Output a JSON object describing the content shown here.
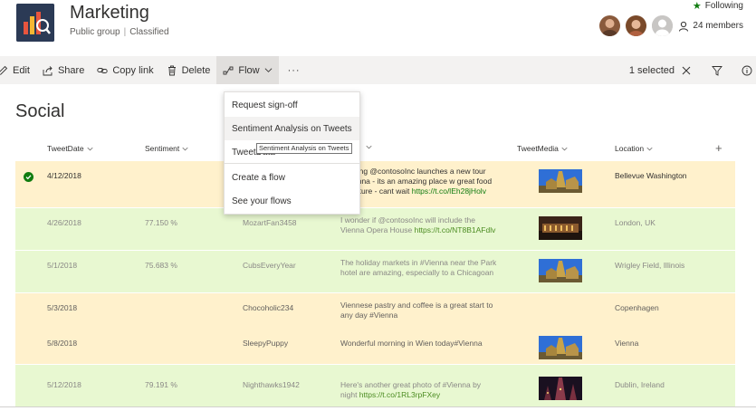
{
  "site": {
    "title": "Marketing",
    "group_type": "Public group",
    "classification": "Classified",
    "following": "Following",
    "members": "24 members"
  },
  "commands": {
    "edit": "Edit",
    "share": "Share",
    "copy_link": "Copy link",
    "delete": "Delete",
    "flow": "Flow",
    "more": "···",
    "selected": "1 selected"
  },
  "flow_menu": {
    "items": [
      "Request sign-off",
      "Sentiment Analysis on Tweets",
      "TweetData",
      "Create a flow",
      "See your flows"
    ],
    "tooltip": "Sentiment Analysis on Tweets"
  },
  "list": {
    "title": "Social",
    "columns": {
      "tweet_date": "TweetDate",
      "sentiment": "Sentiment",
      "tweet_media": "TweetMedia",
      "location": "Location"
    },
    "rows": [
      {
        "date": "4/12/2018",
        "sentiment": "",
        "user": "",
        "tweet_a": "ping @contosoInc launches a new tour",
        "tweet_b": "enna - its an amazing place w great food",
        "tweet_c": "ulture - cant wait ",
        "link": "https://t.co/lEh28jHolv",
        "location": "Bellevue Washington"
      },
      {
        "date": "4/26/2018",
        "sentiment": "77.150 %",
        "user": "MozartFan3458",
        "tweet_a": "I wonder if @contosoInc will include the",
        "tweet_b": "Vienna Opera House ",
        "link": "https://t.co/NT8B1AFdlv",
        "location": "London, UK"
      },
      {
        "date": "5/1/2018",
        "sentiment": "75.683 %",
        "user": "CubsEveryYear",
        "tweet_a": "The holiday markets in #Vienna near the Park",
        "tweet_b": "hotel are amazing, especially to a Chicagoan",
        "location": "Wrigley Field, Illinois"
      },
      {
        "date": "5/3/2018",
        "sentiment": "",
        "user": "Chocoholic234",
        "tweet_a": "Viennese pastry and coffee is a great start to",
        "tweet_b": "any day #Vienna",
        "location": "Copenhagen"
      },
      {
        "date": "5/8/2018",
        "sentiment": "",
        "user": "SleepyPuppy",
        "tweet_a": "Wonderful morning in Wien today#Vienna",
        "location": "Vienna"
      },
      {
        "date": "5/12/2018",
        "sentiment": "79.191 %",
        "user": "Nighthawks1942",
        "tweet_a": "Here's another great photo of #Vienna by",
        "tweet_b": "night ",
        "link": "https://t.co/1RL3rpFXey",
        "location": "Dublin, Ireland"
      }
    ]
  },
  "colors": {
    "accent_green": "#107c10",
    "row_orange": "#fff1cc",
    "row_green": "#e8f8d1",
    "command_bar": "#f3f2f1"
  }
}
